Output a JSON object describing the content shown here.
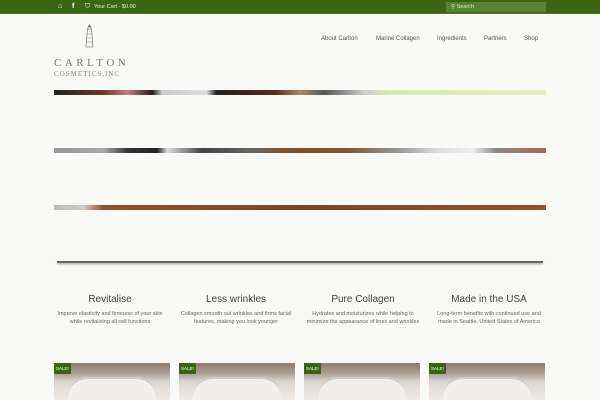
{
  "topbar": {
    "cart": "Your Cart - $0.00",
    "search_placeholder": "Search",
    "icons": [
      "home-icon",
      "facebook-icon",
      "basket-icon",
      "search-icon"
    ]
  },
  "brand": {
    "line1": "CARLTON",
    "line2": "COSMETICS,INC"
  },
  "nav": [
    "About Carlton",
    "Marine Collagen",
    "Ingredients",
    "Partners",
    "Shop"
  ],
  "features": [
    {
      "title": "Revitalise",
      "text": "Improve elasticity and firmness of your skin while revitalising all cell functions"
    },
    {
      "title": "Less wrinkles",
      "text": "Collagen smooth out wrinkles and firms facial features, making you look younger"
    },
    {
      "title": "Pure Collagen",
      "text": "Hydrates and moisturizes while helping to minimize the appearance of lines and wrinkles"
    },
    {
      "title": "Made in the USA",
      "text": "Long-term benefits with continued use and made in Seattle, United States of America"
    }
  ],
  "products": [
    {
      "badge": "SALE!"
    },
    {
      "badge": "SALE!"
    },
    {
      "badge": "SALE!"
    },
    {
      "badge": "SALE!"
    }
  ],
  "colors": {
    "accent": "#3b6513"
  }
}
